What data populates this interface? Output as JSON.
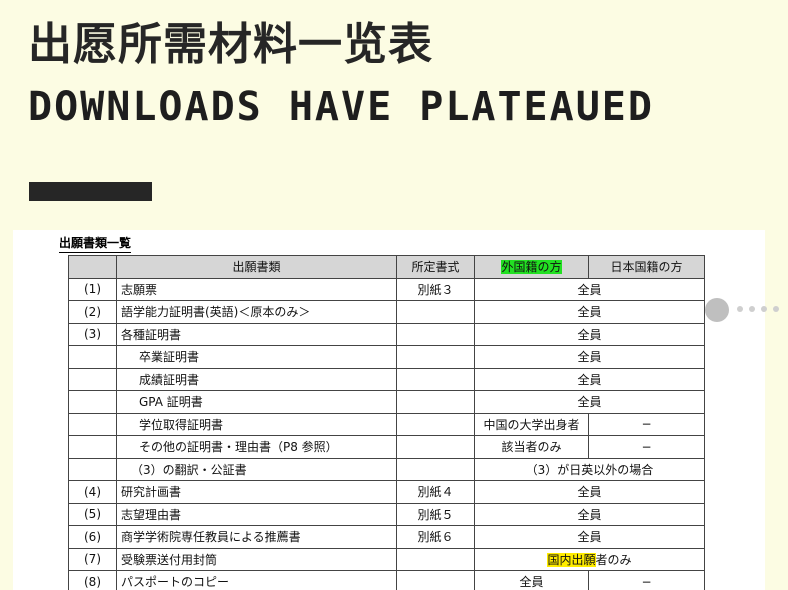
{
  "header": {
    "title": "出愿所需材料一览表",
    "subtitle": "DOWNLOADS HAVE PLATEAUED"
  },
  "document": {
    "heading": "出願書類一覧",
    "columns": [
      "",
      "出願書類",
      "所定書式",
      "外国籍の方",
      "日本国籍の方"
    ],
    "rows": [
      {
        "no": "(1)",
        "name": "志願票",
        "form": "別紙３",
        "all": "全員"
      },
      {
        "no": "(2)",
        "name": "語学能力証明書(英語)＜原本のみ＞",
        "form": "",
        "all": "全員"
      },
      {
        "no": "(3)",
        "name": "各種証明書",
        "form": "",
        "all": "全員"
      },
      {
        "no": "",
        "name": "卒業証明書",
        "form": "",
        "all": "全員"
      },
      {
        "no": "",
        "name": "成績証明書",
        "form": "",
        "all": "全員"
      },
      {
        "no": "",
        "name": "GPA 証明書",
        "form": "",
        "all": "全員"
      },
      {
        "no": "",
        "name": "学位取得証明書",
        "form": "",
        "foreign": "中国の大学出身者",
        "japanese": "−"
      },
      {
        "no": "",
        "name": "その他の証明書・理由書（P8 参照）",
        "form": "",
        "foreign": "該当者のみ",
        "japanese": "−"
      },
      {
        "no": "",
        "name": "（3）の翻訳・公証書",
        "form": "",
        "all": "（3）が日英以外の場合"
      },
      {
        "no": "(4)",
        "name": "研究計画書",
        "form": "別紙４",
        "all": "全員"
      },
      {
        "no": "(5)",
        "name": "志望理由書",
        "form": "別紙５",
        "all": "全員"
      },
      {
        "no": "(6)",
        "name": "商学学術院専任教員による推薦書",
        "form": "別紙６",
        "all": "全員"
      },
      {
        "no": "(7)",
        "name": "受験票送付用封筒",
        "form": "",
        "all_hl": "国内出願",
        "all_rest": "者のみ"
      },
      {
        "no": "(8)",
        "name": "パスポートのコピー",
        "form": "",
        "foreign": "全員",
        "japanese": "−"
      }
    ]
  },
  "colors": {
    "background": "#fcfce3",
    "highlight_green": "#22e022",
    "highlight_yellow": "#ffec00",
    "header_gray": "#d6d6d6"
  }
}
